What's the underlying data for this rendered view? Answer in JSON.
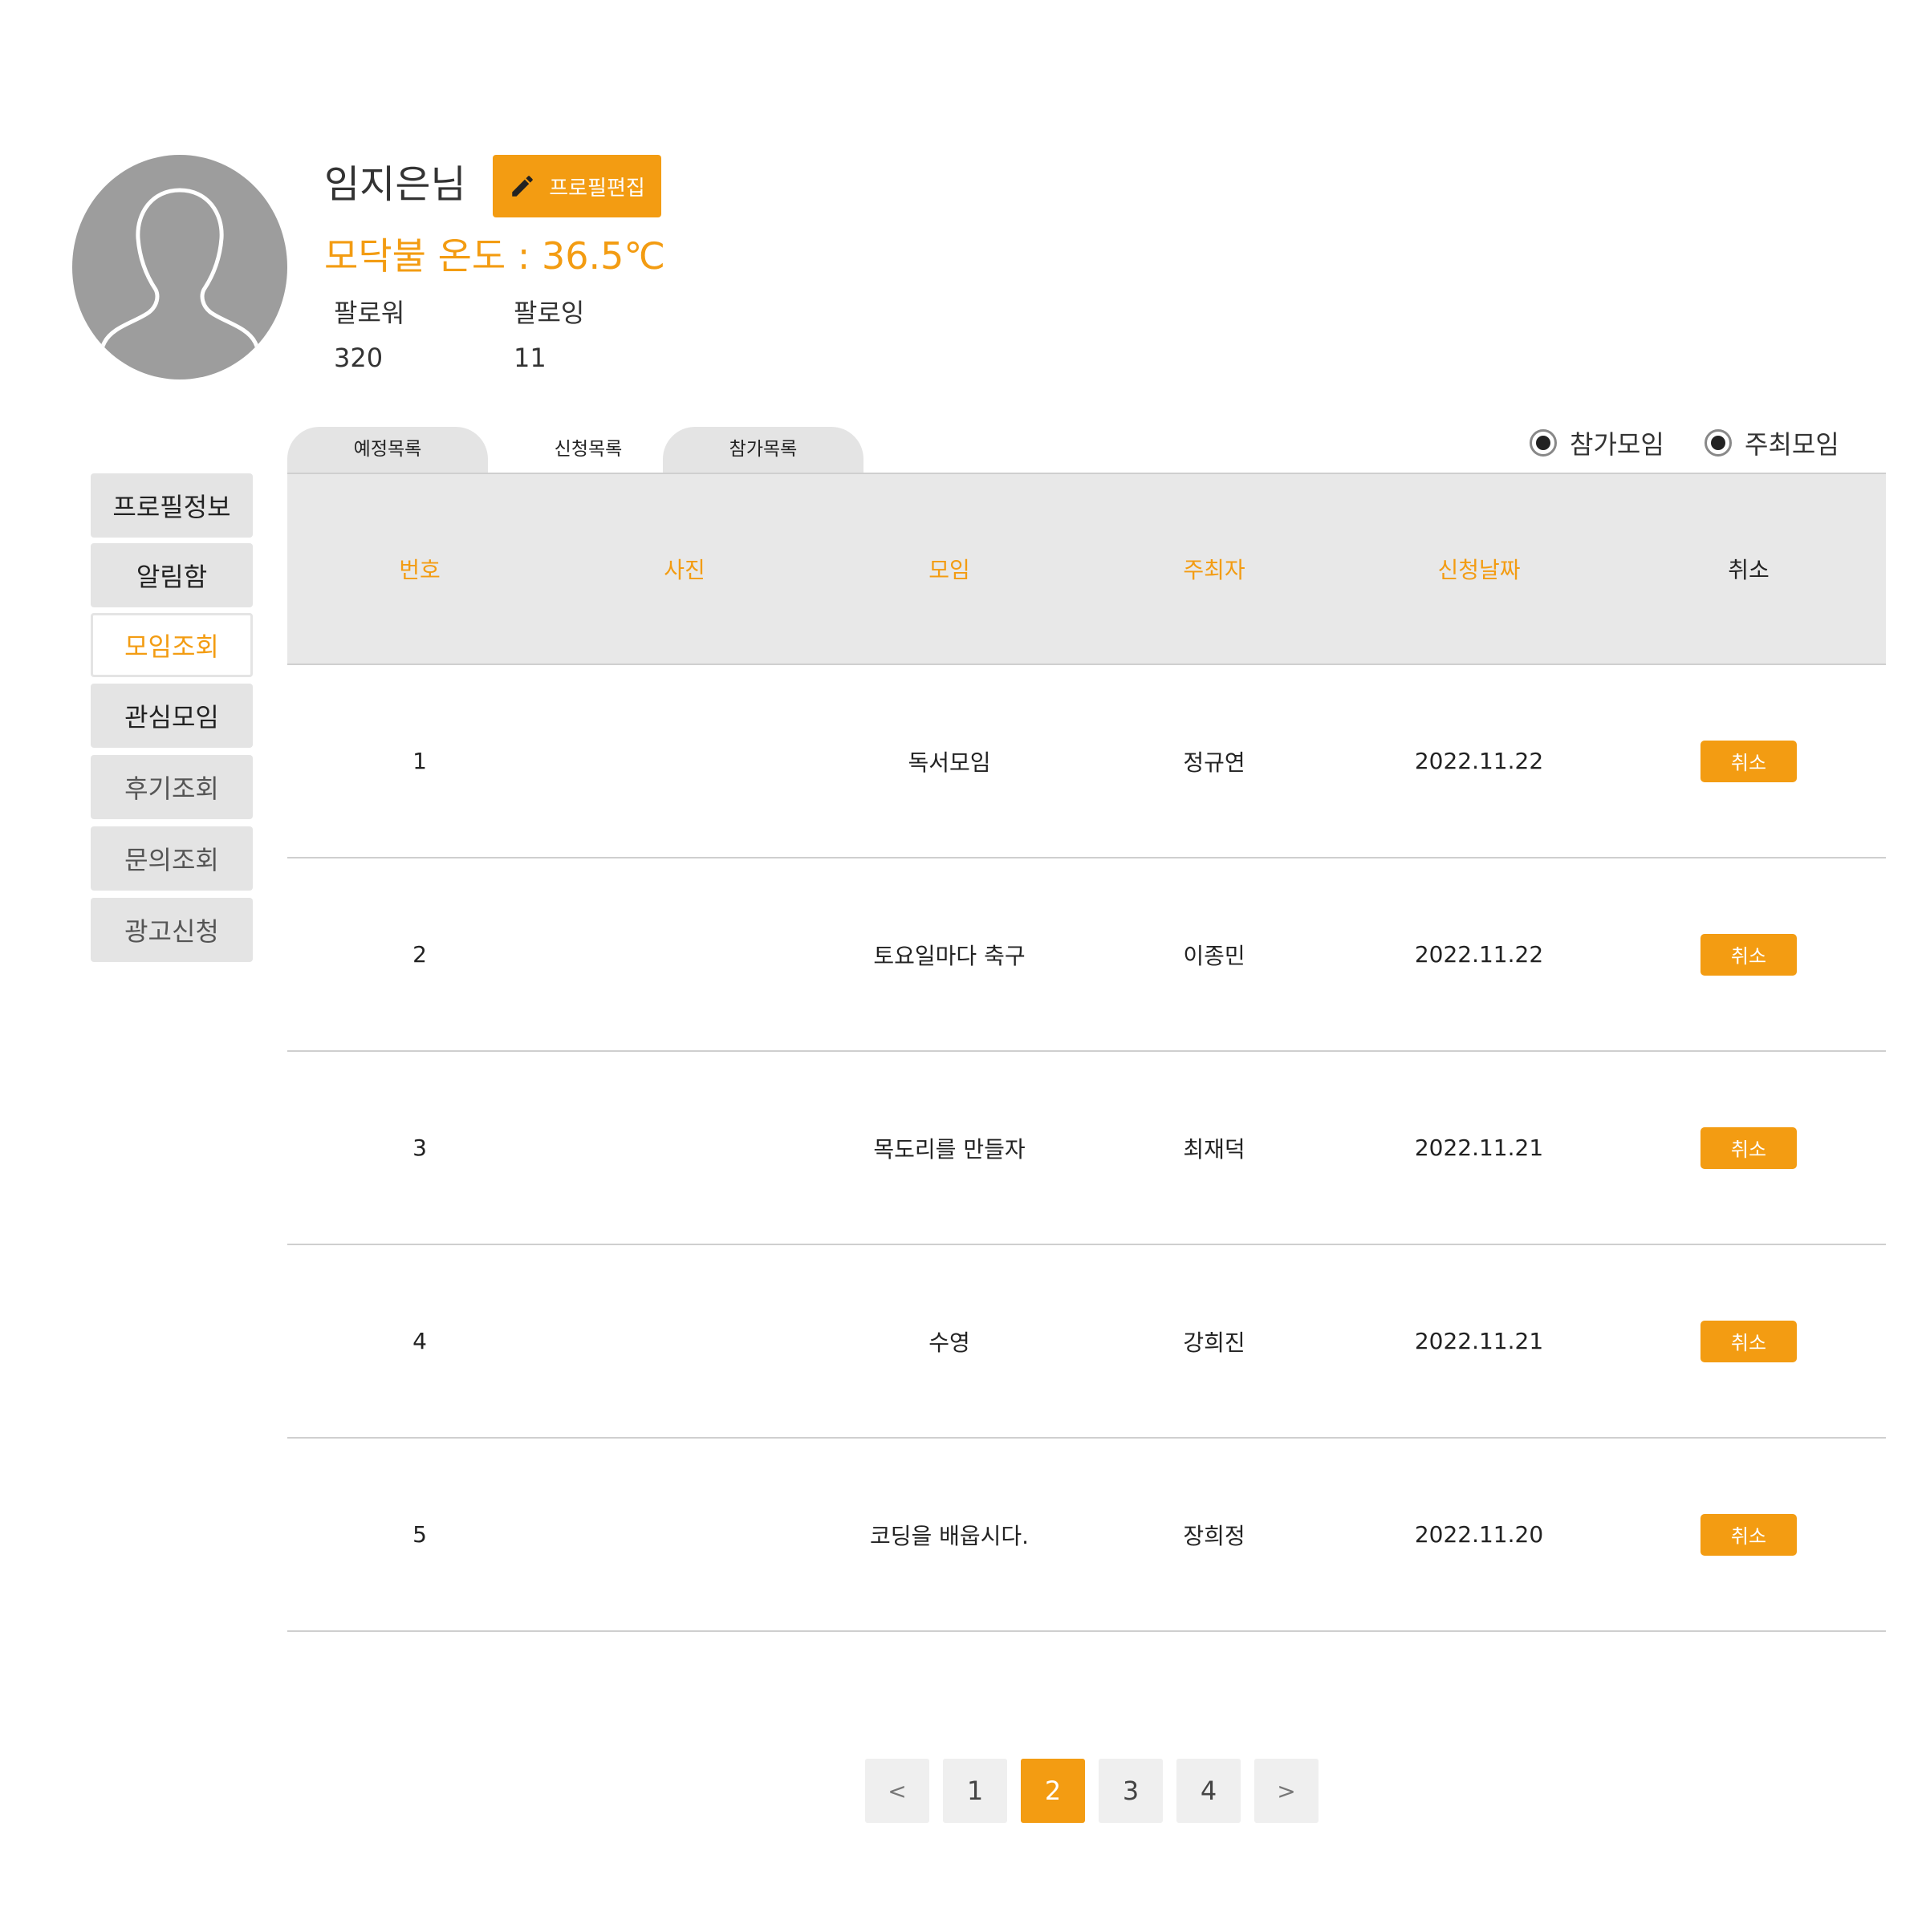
{
  "profile": {
    "name": "임지은님",
    "edit_label": "프로필편집",
    "temperature": "모닥불 온도 : 36.5℃",
    "followers_label": "팔로워",
    "followers_count": "320",
    "following_label": "팔로잉",
    "following_count": "11"
  },
  "sidebar": {
    "items": [
      {
        "label": "프로필정보"
      },
      {
        "label": "알림함"
      },
      {
        "label": "모임조회"
      },
      {
        "label": "관심모임"
      },
      {
        "label": "후기조회"
      },
      {
        "label": "문의조회"
      },
      {
        "label": "광고신청"
      }
    ],
    "active": "모임조회"
  },
  "tabs": [
    {
      "label": "예정목록"
    },
    {
      "label": "신청목록"
    },
    {
      "label": "참가목록"
    }
  ],
  "filters": [
    {
      "label": "참가모임",
      "selected": true
    },
    {
      "label": "주최모임",
      "selected": true
    }
  ],
  "table": {
    "headers": [
      "번호",
      "사진",
      "모임",
      "주최자",
      "신청날짜",
      "취소"
    ],
    "rows": [
      {
        "no": "1",
        "meeting": "독서모임",
        "host": "정규연",
        "date": "2022.11.22",
        "action": "취소"
      },
      {
        "no": "2",
        "meeting": "토요일마다 축구",
        "host": "이종민",
        "date": "2022.11.22",
        "action": "취소"
      },
      {
        "no": "3",
        "meeting": "목도리를 만들자",
        "host": "최재덕",
        "date": "2022.11.21",
        "action": "취소"
      },
      {
        "no": "4",
        "meeting": "수영",
        "host": "강희진",
        "date": "2022.11.21",
        "action": "취소"
      },
      {
        "no": "5",
        "meeting": "코딩을 배웁시다.",
        "host": "장희정",
        "date": "2022.11.20",
        "action": "취소"
      }
    ]
  },
  "pagination": {
    "prev": "<",
    "pages": [
      "1",
      "2",
      "3",
      "4"
    ],
    "current": "2",
    "next": ">"
  },
  "colors": {
    "accent": "#f39c12",
    "header_bg": "#e8e8e8",
    "sidebar_bg": "#e4e4e4",
    "avatar_bg": "#9d9d9d"
  }
}
